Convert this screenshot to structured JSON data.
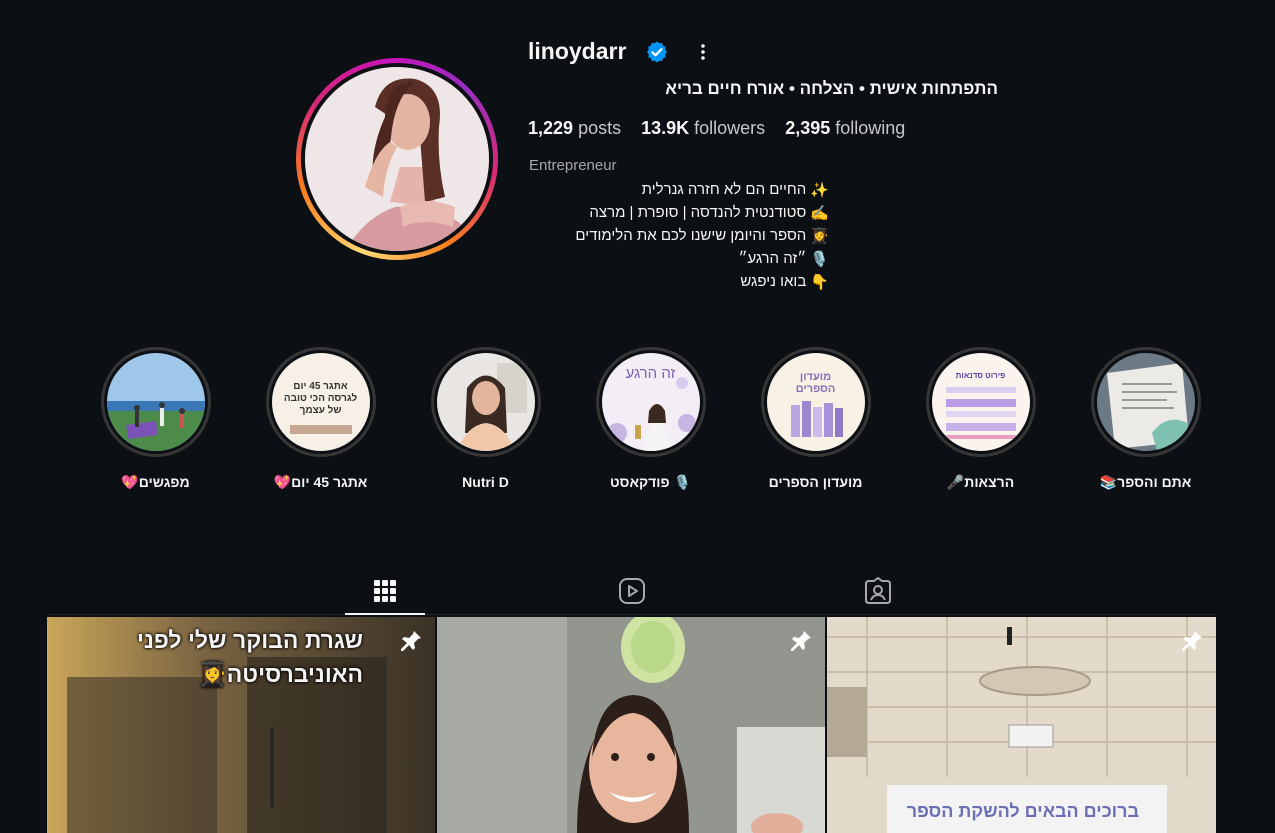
{
  "profile": {
    "username": "linoydarr",
    "full_name": "התפתחות אישית • הצלחה • אורח חיים בריא",
    "stats": {
      "posts_count": "1,229",
      "posts_label": "posts",
      "followers_count": "13.9K",
      "followers_label": "followers",
      "following_count": "2,395",
      "following_label": "following"
    },
    "category": "Entrepreneur",
    "bio_lines": [
      {
        "text": "החיים הם לא חזרה גנרלית",
        "emoji": "✨"
      },
      {
        "text": "סטודנטית להנדסה | סופרת | מרצה",
        "emoji": "✍️"
      },
      {
        "text": "הספר והיומן שישנו לכם את הלימודים",
        "emoji": "👩‍🎓"
      },
      {
        "text": "״זה הרגע״",
        "emoji": "🎙️"
      },
      {
        "text": "בואו ניפגש",
        "emoji": "👇"
      }
    ]
  },
  "highlights": [
    {
      "label": "מפגשים💖"
    },
    {
      "label": "אתגר 45 יום💖",
      "cover_text": "אתגר 45 יום לגרסה הכי טובה של עצמך"
    },
    {
      "label": "Nutri D"
    },
    {
      "label": "🎙️ פודקאסט",
      "cover_text": "זה הרגע"
    },
    {
      "label": "מועדון הספרים",
      "cover_text": "מועדון הספרים"
    },
    {
      "label": "הרצאות🎤",
      "cover_text": "פירוט סדנאות"
    },
    {
      "label": "אתם והספר📚"
    }
  ],
  "tabs": [
    {
      "name": "posts",
      "icon": "grid-icon",
      "active": true
    },
    {
      "name": "reels",
      "icon": "reels-icon",
      "active": false
    },
    {
      "name": "tagged",
      "icon": "tagged-icon",
      "active": false
    }
  ],
  "posts": [
    {
      "caption_line1": "שגרת הבוקר שלי לפני",
      "caption_line2": "האוניברסיטה👩‍🎓",
      "pinned": true
    },
    {
      "pinned": true
    },
    {
      "banner_text": "ברוכים הבאים להשקת הספר",
      "pinned": true
    }
  ],
  "colors": {
    "background": "#0c1014",
    "verified": "#0095f6",
    "text": "#f5f5f5",
    "muted": "#a8a8a8"
  }
}
